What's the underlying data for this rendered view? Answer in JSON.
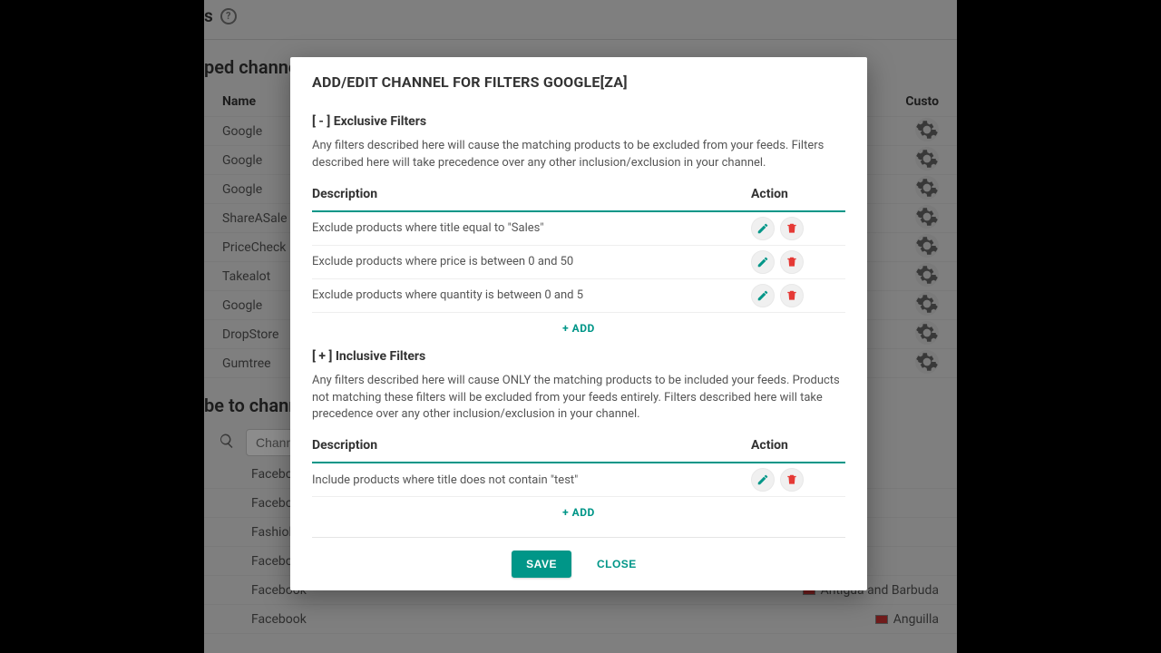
{
  "bg": {
    "page_title_visible": "s",
    "section1_title": "ped channels:",
    "col_name": "Name",
    "col_custom": "Custo",
    "mapped": [
      {
        "name": "Google"
      },
      {
        "name": "Google"
      },
      {
        "name": "Google"
      },
      {
        "name": "ShareASale"
      },
      {
        "name": "PriceCheck"
      },
      {
        "name": "Takealot"
      },
      {
        "name": "Google"
      },
      {
        "name": "DropStore"
      },
      {
        "name": "Gumtree"
      }
    ],
    "section2_title": "be to chann",
    "search_placeholder": "Chann",
    "available": [
      {
        "name": "Faceboc"
      },
      {
        "name": "Faceboc"
      },
      {
        "name": "Fashiola"
      },
      {
        "name": "Faceboc"
      },
      {
        "name": "Facebook",
        "country": "Antigua and Barbuda"
      },
      {
        "name": "Facebook",
        "country": "Anguilla"
      }
    ]
  },
  "modal": {
    "title": "ADD/EDIT CHANNEL FOR FILTERS GOOGLE[ZA]",
    "exclusive": {
      "header": "[ - ] Exclusive Filters",
      "desc": "Any filters described here will cause the matching products to be excluded from your feeds. Filters described here will take precedence over any other inclusion/exclusion in your channel.",
      "col_desc": "Description",
      "col_action": "Action",
      "rows": [
        "Exclude products where title equal to \"Sales\"",
        "Exclude products where price is between 0 and 50",
        "Exclude products where quantity is between 0 and 5"
      ],
      "add": "+ ADD"
    },
    "inclusive": {
      "header": "[ + ] Inclusive Filters",
      "desc": "Any filters described here will cause ONLY the matching products to be included your feeds. Products not matching these filters will be excluded from your feeds entirely. Filters described here will take precedence over any other inclusion/exclusion in your channel.",
      "col_desc": "Description",
      "col_action": "Action",
      "rows": [
        "Include products where title does not contain \"test\""
      ],
      "add": "+ ADD"
    },
    "save": "SAVE",
    "close": "CLOSE"
  }
}
